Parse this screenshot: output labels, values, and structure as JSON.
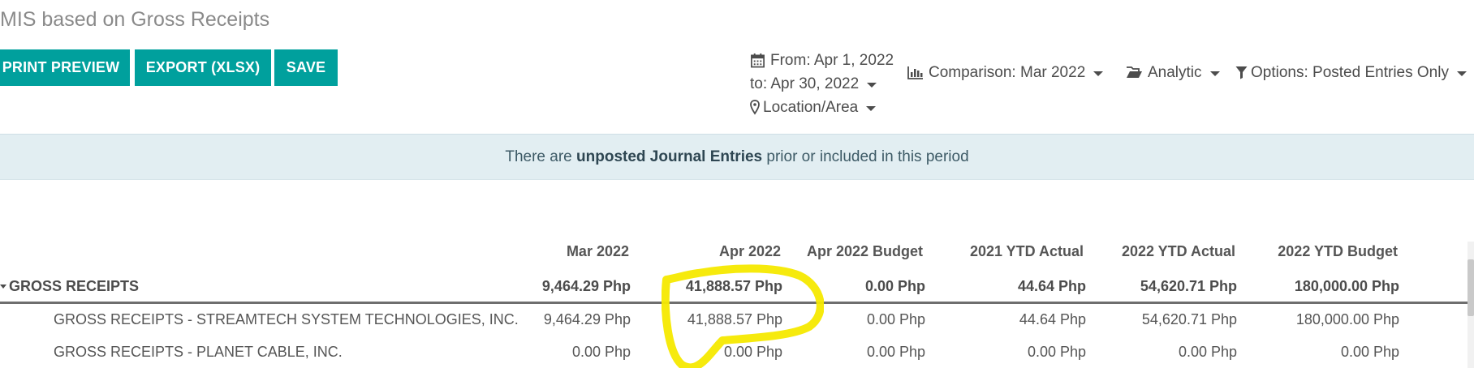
{
  "page": {
    "title": "MIS based on Gross Receipts"
  },
  "buttons": {
    "print_preview": "PRINT PREVIEW",
    "export": "EXPORT (XLSX)",
    "save": "SAVE"
  },
  "filters": {
    "from": "From: Apr 1, 2022",
    "to": "to: Apr 30, 2022",
    "location": "Location/Area",
    "comparison": "Comparison: Mar 2022",
    "analytic": "Analytic",
    "options": "Options: Posted Entries Only"
  },
  "alert": {
    "prefix": "There are ",
    "bold": "unposted Journal Entries",
    "suffix": " prior or included in this period"
  },
  "table": {
    "columns": [
      "Mar 2022",
      "Apr 2022",
      "Apr 2022 Budget",
      "2021 YTD Actual",
      "2022 YTD Actual",
      "2022 YTD Budget"
    ],
    "rows": [
      {
        "label": "GROSS RECEIPTS",
        "values": [
          "9,464.29 Php",
          "41,888.57 Php",
          "0.00 Php",
          "44.64 Php",
          "54,620.71 Php",
          "180,000.00 Php"
        ]
      },
      {
        "label": "GROSS RECEIPTS - STREAMTECH SYSTEM TECHNOLOGIES, INC.",
        "values": [
          "9,464.29 Php",
          "41,888.57 Php",
          "0.00 Php",
          "44.64 Php",
          "54,620.71 Php",
          "180,000.00 Php"
        ]
      },
      {
        "label": "GROSS RECEIPTS - PLANET CABLE, INC.",
        "values": [
          "0.00 Php",
          "0.00 Php",
          "0.00 Php",
          "0.00 Php",
          "0.00 Php",
          "0.00 Php"
        ]
      }
    ]
  },
  "icons": {
    "calendar": "calendar-icon",
    "map_marker": "map-marker-icon",
    "bar_chart": "bar-chart-icon",
    "folder": "folder-open-icon",
    "filter": "filter-icon",
    "caret": "caret-down-icon"
  },
  "colors": {
    "primary": "#00a09d",
    "alert_bg": "#e2eef2",
    "annotation": "#f5e900"
  }
}
